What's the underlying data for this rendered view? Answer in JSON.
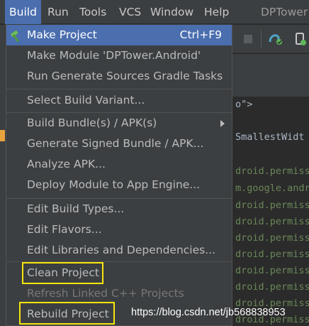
{
  "menubar": {
    "items": [
      "Build",
      "Run",
      "Tools",
      "VCS",
      "Window",
      "Help"
    ],
    "title": "DPTower"
  },
  "icons": {
    "make_project": "hammer-icon",
    "submenu": "chevron-right-icon",
    "stop": "stop-icon",
    "sync": "gradle-sync-icon",
    "device": "device-manager-icon"
  },
  "build_menu": {
    "groups": [
      [
        {
          "label": "Make Project",
          "shortcut": "Ctrl+F9"
        },
        {
          "label": "Make Module 'DPTower.Android'"
        },
        {
          "label": "Run Generate Sources Gradle Tasks"
        }
      ],
      [
        {
          "label": "Select Build Variant..."
        }
      ],
      [
        {
          "label": "Build Bundle(s) / APK(s)"
        },
        {
          "label": "Generate Signed Bundle / APK..."
        },
        {
          "label": "Analyze APK..."
        },
        {
          "label": "Deploy Module to App Engine..."
        }
      ],
      [
        {
          "label": "Edit Build Types..."
        },
        {
          "label": "Edit Flavors..."
        },
        {
          "label": "Edit Libraries and Dependencies..."
        }
      ],
      [
        {
          "label": "Clean Project"
        },
        {
          "label": "Refresh Linked C++ Projects"
        },
        {
          "label": "Rebuild Project"
        }
      ]
    ]
  },
  "editor": {
    "lines": [
      "o\">",
      "SmallestWidt",
      "",
      "droid.permiss",
      "m.google.andr",
      "droid.permiss",
      "droid.permiss",
      "droid.permiss",
      "droid.permiss",
      "droid.permiss",
      "droid.permiss",
      "droid.permiss",
      "droid.permiss"
    ]
  },
  "watermark": "https://blog.csdn.net/jb568838953",
  "colors": {
    "menu_bg": "#3c3f41",
    "selection": "#4b6eaf",
    "highlight_box": "#f5e50b",
    "editor_bg": "#2b2b2b",
    "string_green": "#6a8759"
  }
}
